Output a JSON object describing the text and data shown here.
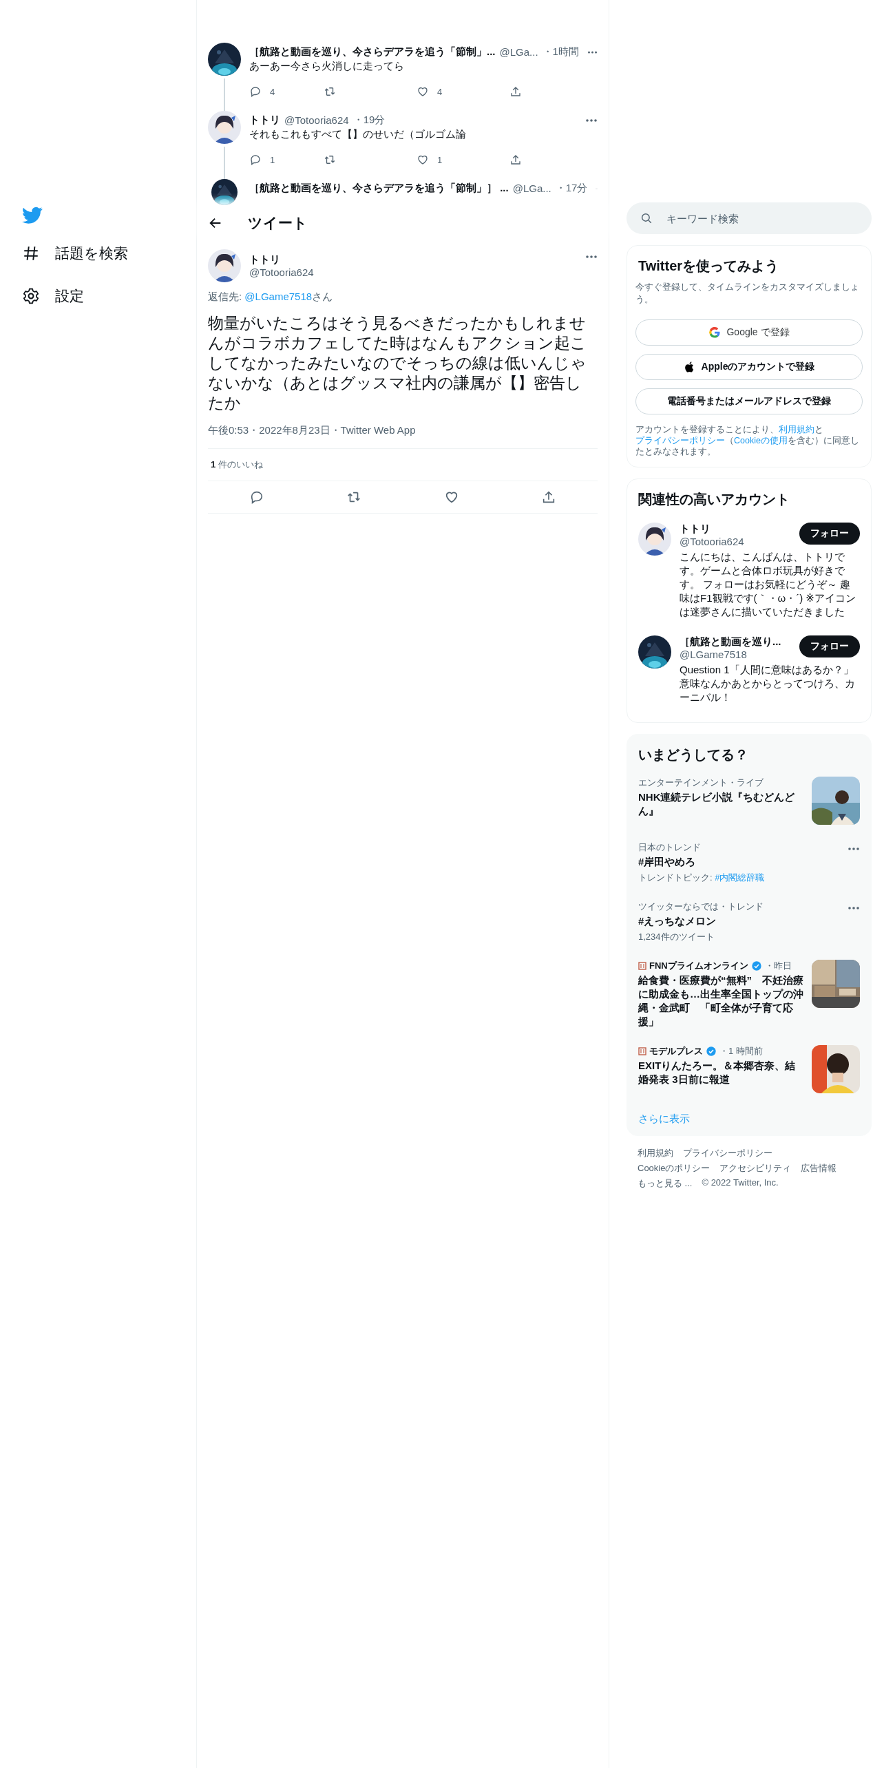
{
  "sidebar": {
    "items": [
      {
        "label": "話題を検索",
        "kind": "explore"
      },
      {
        "label": "設定",
        "kind": "settings"
      }
    ]
  },
  "thread": [
    {
      "name": "［航路と動画を巡り、今さらデアラを追う「節制」...",
      "handle": "@LGa...",
      "time": "・1時間",
      "text": "あーあー今さら火消しに走ってら",
      "kind": "dark",
      "replies": "4",
      "likes": "4"
    },
    {
      "name": "トトリ",
      "handle": "@Totooria624",
      "time": "・19分",
      "text": "それもこれもすべて【】のせいだ（ゴルゴム論",
      "kind": "figure",
      "replies": "1",
      "likes": "1"
    },
    {
      "name": "［航路と動画を巡り、今さらデアラを追う「節制」］ ...",
      "handle": "@LGa...",
      "time": "・17分",
      "kind": "dark"
    }
  ],
  "header": {
    "title": "ツイート"
  },
  "tweet": {
    "name": "トトリ",
    "handle": "@Totooria624",
    "kind": "figure",
    "reply_prefix": "返信先: ",
    "reply_to": "@LGame7518",
    "reply_suffix": "さん",
    "text": "物量がいたころはそう見るべきだったかもしれませんがコラボカフェしてた時はなんもアクション起こしてなかったみたいなのでそっちの線は低いんじゃないかな（あとはグッスマ社内の謙属が【】密告したか",
    "meta": "午後0:53・2022年8月23日・Twitter Web App",
    "likes_count": "1",
    "likes_label": "件のいいね"
  },
  "search": {
    "placeholder": "キーワード検索"
  },
  "signup": {
    "title": "Twitterを使ってみよう",
    "description": "今すぐ登録して、タイムラインをカスタマイズしましょう。",
    "buttons": [
      {
        "label": "Google で登録",
        "kind": "google"
      },
      {
        "label": "Appleのアカウントで登録",
        "kind": "apple"
      },
      {
        "label": "電話番号またはメールアドレスで登録",
        "kind": "plain"
      }
    ],
    "legal": [
      {
        "text": "アカウントを登録することにより、",
        "link": false
      },
      {
        "text": "利用規約",
        "link": true
      },
      {
        "text": "と",
        "link": false
      },
      {
        "text": "プライバシーポリシー",
        "link": true
      },
      {
        "text": "（",
        "link": false
      },
      {
        "text": "Cookieの使用",
        "link": true
      },
      {
        "text": "を含む）に同意したとみなされます。",
        "link": false
      }
    ]
  },
  "accounts": {
    "title": "関連性の高いアカウント",
    "items": [
      {
        "name": "トトリ",
        "handle": "@Totooria624",
        "kind": "figure",
        "button": "フォロー",
        "bio": "こんにちは、こんばんは、トトリです。ゲームと合体ロボ玩具が好きです。 フォローはお気軽にどうぞ～ 趣味はF1観戦です(｀・ω・´) ※アイコンは迷夢さんに描いていただきました"
      },
      {
        "name": "［航路と動画を巡り...",
        "handle": "@LGame7518",
        "kind": "dark",
        "button": "フォロー",
        "bio": "Question 1「人間に意味はあるか？」意味なんかあとからとってつけろ、カーニバル！"
      }
    ]
  },
  "trends": {
    "title": "いまどうしてる？",
    "items": [
      {
        "kind": "trend",
        "category": "エンターテインメント・ライブ",
        "title": "NHK連続テレビ小説『ちむどんどん』",
        "thumbnail": true,
        "more": false
      },
      {
        "kind": "trend",
        "category": "日本のトレンド",
        "title": "#岸田やめろ",
        "sub": "トレンドトピック: ",
        "sub_link": "#内閣総辞職",
        "thumbnail": false,
        "more": true
      },
      {
        "kind": "trend",
        "category": "ツイッターならでは・トレンド",
        "title": "#えっちなメロン",
        "sub": "1,234件のツイート",
        "thumbnail": false,
        "more": true
      },
      {
        "kind": "news",
        "source": "FNNプライムオンライン",
        "verified": true,
        "time": "・昨日",
        "title": "給食費・医療費が“無料”　不妊治療に助成金も…出生率全国トップの沖縄・金武町　「町全体が子育て応援」",
        "thumbnail": true,
        "more": false
      },
      {
        "kind": "news",
        "source": "モデルプレス",
        "verified": true,
        "time": "・1 時間前",
        "title": "EXITりんたろー。＆本郷杏奈、結婚発表 3日前に報道",
        "thumbnail": true,
        "more": false
      }
    ],
    "show_more": "さらに表示"
  },
  "footer": [
    "利用規約",
    "プライバシーポリシー",
    "Cookieのポリシー",
    "アクセシビリティ",
    "広告情報",
    "もっと見る ...",
    "© 2022 Twitter, Inc."
  ]
}
